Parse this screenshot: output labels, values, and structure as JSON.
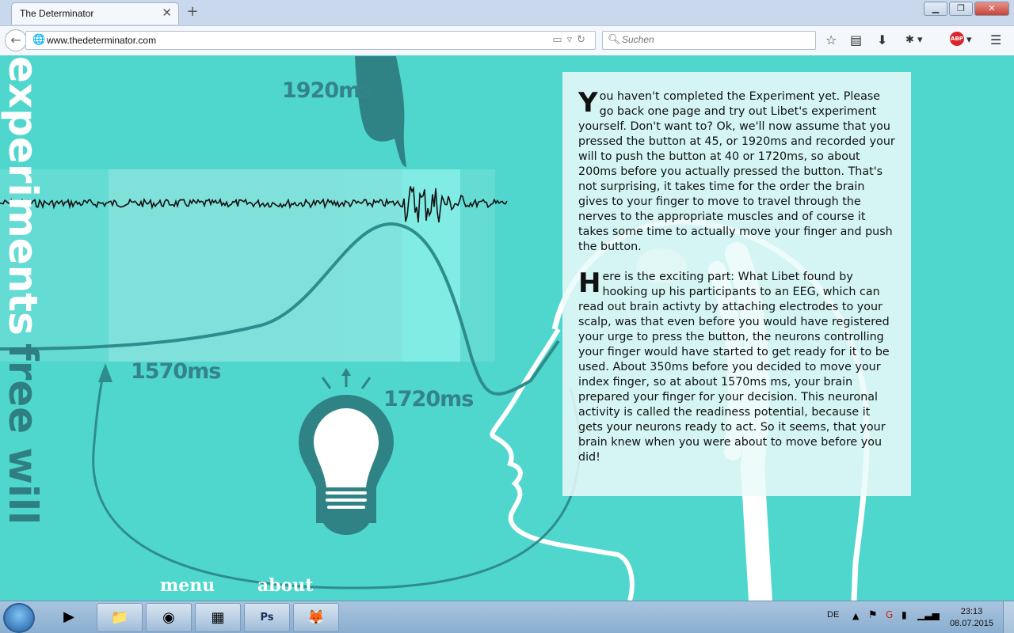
{
  "browser": {
    "tab_title": "The Determinator",
    "tab_close": "✕",
    "new_tab": "+",
    "url": "www.thedeterminator.com",
    "search_placeholder": "Suchen",
    "window_controls": {
      "minimize": "▁",
      "maximize": "❐",
      "close": "✕"
    },
    "toolbar_icons": [
      "bookmark-star-icon",
      "reading-list-icon",
      "download-icon",
      "addon-icon",
      "adblock-plus-icon",
      "menu-icon"
    ],
    "abp_label": "ABP"
  },
  "page": {
    "vertical_title_part1": "experiments",
    "vertical_title_part2": "free will",
    "timings": {
      "t1920": "1920ms",
      "t1570": "1570ms",
      "t1720": "1720ms"
    },
    "paragraph1": {
      "dropcap": "Y",
      "text": "ou haven't completed the Experiment yet. Please go back one page and try out Libet's experiment yourself. Don't want to? Ok, we'll now assume that you pressed the button at 45, or 1920ms and recorded your will to push the button at 40 or 1720ms, so about 200ms before you actually pressed the button. That's not surprising, it takes time for the order the brain gives to your finger to move to travel through the nerves to the appropriate muscles and of course it takes some time to actually move your finger and push the button."
    },
    "paragraph2": {
      "dropcap": "H",
      "text": "ere is the exciting part: What Libet found by hooking up his participants to an EEG, which can read out brain activty by attaching electrodes to your scalp, was that even before you would have registered your urge to press the button, the neurons controlling your finger would have started to get ready for it to be used. About 350ms before you decided to move your index finger, so at about 1570ms ms, your brain prepared your finger for your decision. This neuronal activity is called the readiness potential, because it gets your neurons ready to act. So it seems, that your brain knew when you were about to move before you did!"
    },
    "nav": {
      "menu": "menu",
      "about": "about"
    },
    "colors": {
      "background": "#4fd6cd",
      "dark_teal": "#2f7f82",
      "white": "#ffffff"
    }
  },
  "taskbar": {
    "apps": [
      "media-player-icon",
      "file-explorer-icon",
      "chrome-icon",
      "archive-icon",
      "photoshop-icon",
      "firefox-icon"
    ],
    "ps_label": "Ps",
    "language": "DE",
    "time": "23:13",
    "date": "08.07.2015"
  }
}
